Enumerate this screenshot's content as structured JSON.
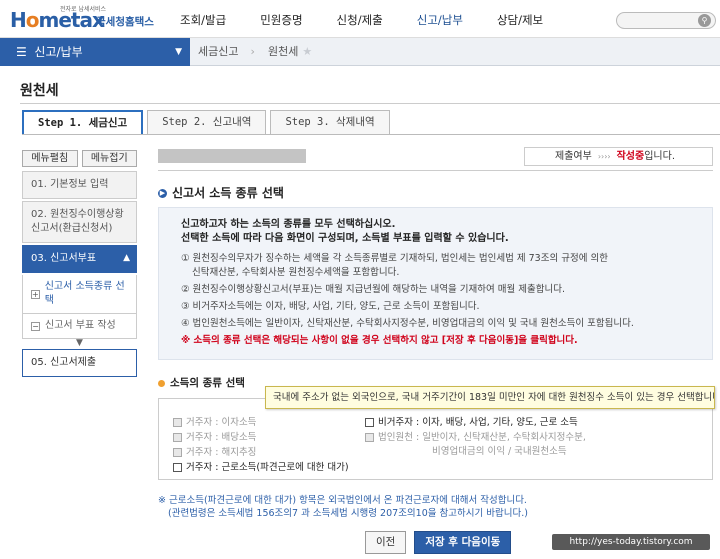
{
  "header": {
    "logo_text": "Hometax",
    "logo_small": "전자로 납세서비스",
    "logo_sub": "국세청홈택스",
    "gnb": [
      "조회/발급",
      "민원증명",
      "신청/제출",
      "신고/납부",
      "상담/제보"
    ],
    "search_icon": "search-icon"
  },
  "nav": {
    "main": "신고/납부",
    "crumbs": [
      "세금신고",
      "원천세"
    ]
  },
  "page_title": "원천세",
  "tabs": [
    "Step 1. 세금신고",
    "Step 2. 신고내역",
    "Step 3. 삭제내역"
  ],
  "sidebar": {
    "btn_expand": "메뉴펼침",
    "btn_collapse": "메뉴접기",
    "item1": "01. 기본정보 입력",
    "item2": "02. 원천징수이행상황신고서(환급신청서)",
    "item3": "03. 신고서부표",
    "sub1": "신고서 소득종류 선택",
    "sub2": "신고서 부표 작성",
    "item5": "05. 신고서제출"
  },
  "status": {
    "label": "제출여부",
    "arrows": "››››",
    "value": "작성중",
    "suffix": "입니다."
  },
  "section": {
    "title": "신고서 소득 종류 선택",
    "lead1": "신고하고자 하는 소득의 종류를 모두 선택하십시오.",
    "lead2": "선택한 소득에 따라 다음 화면이 구성되며, 소득별 부표를 입력할 수 있습니다.",
    "items": [
      "① 원천징수의무자가 징수하는 세액을 각 소득종류별로 기재하되, 법인세는 법인세법 제 73조의 규정에 의한",
      "    신탁재산분, 수탁회사분 원천징수세액을 포함합니다.",
      "② 원천징수이행상황신고서(부표)는 매월 지급년월에 해당하는 내역을 기재하여 매월 제출합니다.",
      "③ 비거주자소득에는 이자, 배당, 사업, 기타, 양도, 근로 소득이 포함됩니다.",
      "④ 법인원천소득에는 일반이자, 신탁재산분, 수탁회사지정수분, 비영업대금의 이익 및 국내 원천소득이 포함됩니다."
    ],
    "warning": "※ 소득의 종류 선택은 해당되는 사항이 없을 경우 선택하지 않고 [저장 후 다음이동]을 클릭합니다."
  },
  "kinds": {
    "title": "소득의 종류 선택",
    "tooltip": "국내에 주소가 없는 외국인으로, 국내 거주기간이 183일 미만인 자에 대한 원천징수 소득이 있는 경우 선택합니다.",
    "left": [
      "거주자 : 이자소득",
      "거주자 : 배당소득",
      "거주자 : 해지추징",
      "거주자 : 근로소득(파견근로에 대한 대가)"
    ],
    "right1": "비거주자 : 이자, 배당, 사업, 기타, 양도, 근로 소득",
    "right2a": "법인원천 : 일반이자, 신탁재산분, 수탁회사지정수분,",
    "right2b": "비영업대금의 이익 / 국내원천소득"
  },
  "note": {
    "line1": "※ 근로소득(파견근로에 대한 대가) 항목은 외국법인에서 온 파견근로자에 대해서 작성합니다.",
    "line2": "(관련법령은 소득세법 156조의7 과 소득세법 시행령 207조의10을 참고하시기 바랍니다.)"
  },
  "buttons": {
    "prev": "이전",
    "next": "저장 후 다음이동"
  },
  "watermark": "http://yes-today.tistory.com"
}
